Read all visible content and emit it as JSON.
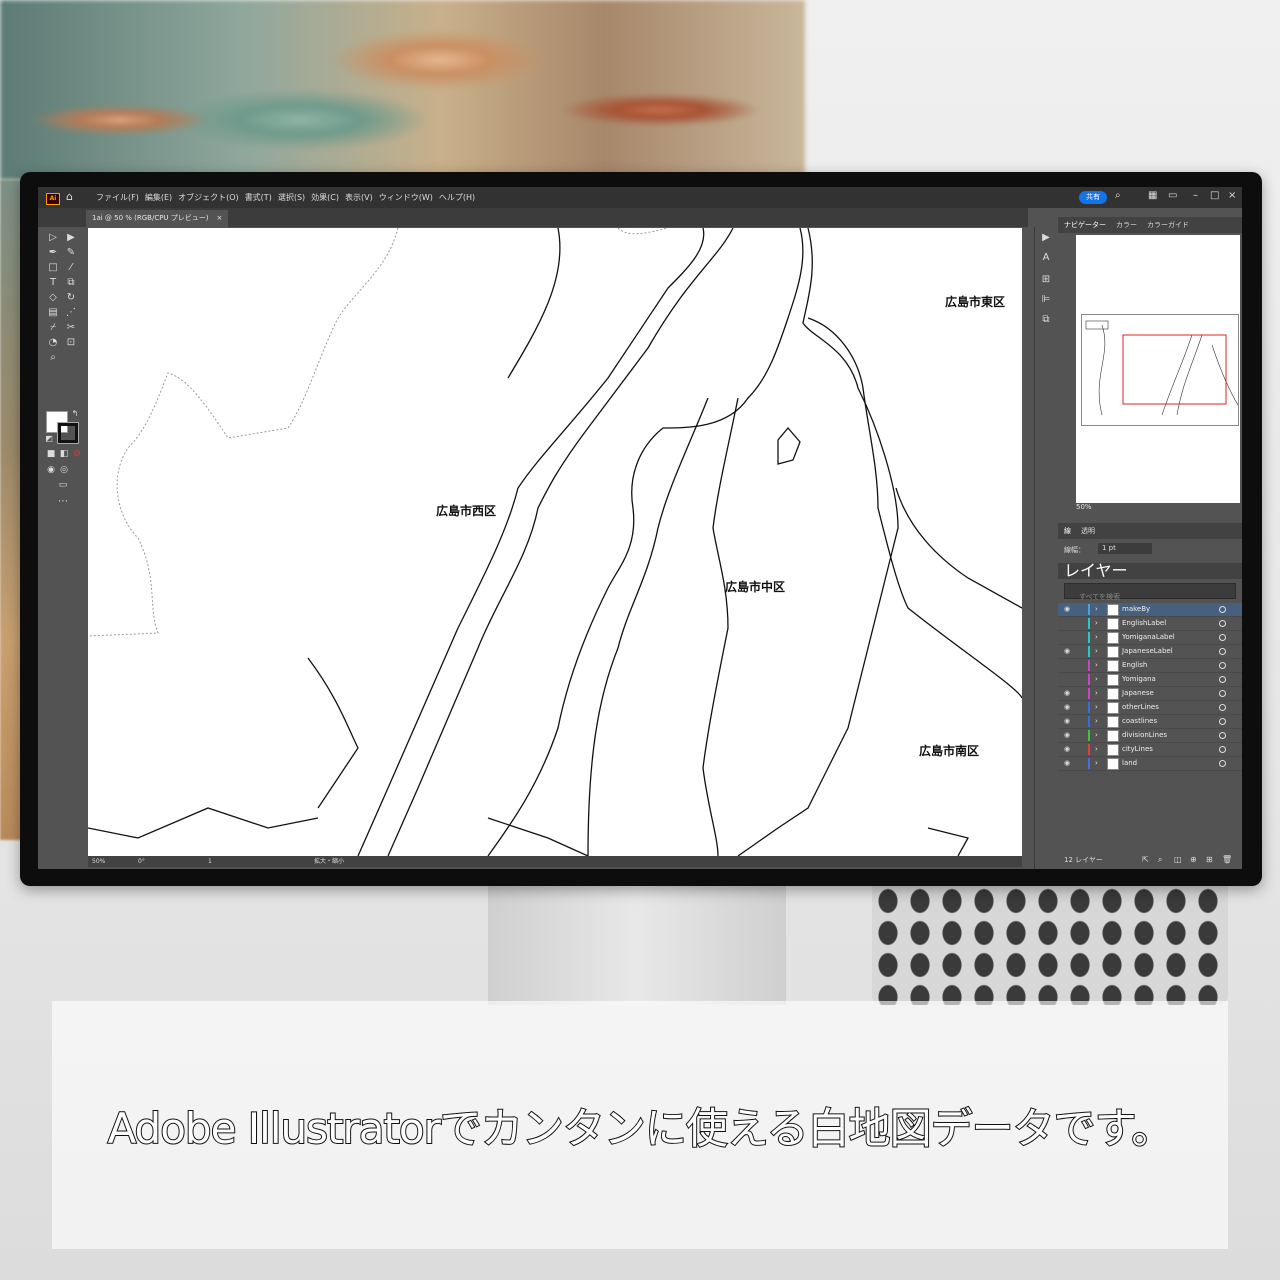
{
  "app": {
    "logo_text": "Ai",
    "menu": [
      "ファイル(F)",
      "編集(E)",
      "オブジェクト(O)",
      "書式(T)",
      "選択(S)",
      "効果(C)",
      "表示(V)",
      "ウィンドウ(W)",
      "ヘルプ(H)"
    ],
    "share_label": "共有",
    "document_tab": "1ai @ 50 % (RGB/CPU プレビュー)",
    "document_tab_close": "×"
  },
  "map": {
    "labels": {
      "higashi": "広島市東区",
      "nishi": "広島市西区",
      "naka": "広島市中区",
      "minami": "広島市南区"
    }
  },
  "navigator": {
    "tabs": [
      "ナビゲーター",
      "カラー",
      "カラーガイド"
    ],
    "zoom": "50%"
  },
  "stroke_panel": {
    "tabs": [
      "線",
      "透明"
    ],
    "weight_label": "線幅：",
    "weight_value": "1 pt"
  },
  "layers_panel": {
    "tab": "レイヤー",
    "search_placeholder": "すべてを検索",
    "layers": [
      {
        "name": "makeBy",
        "color": "#4aa3df",
        "visible": true,
        "selected": true
      },
      {
        "name": "EnglishLabel",
        "color": "#2bc6c6",
        "visible": false,
        "selected": false
      },
      {
        "name": "YomiganaLabel",
        "color": "#2bc6c6",
        "visible": false,
        "selected": false
      },
      {
        "name": "JapaneseLabel",
        "color": "#2bc6c6",
        "visible": true,
        "selected": false
      },
      {
        "name": "English",
        "color": "#c447c4",
        "visible": false,
        "selected": false
      },
      {
        "name": "Yomigana",
        "color": "#c447c4",
        "visible": false,
        "selected": false
      },
      {
        "name": "Japanese",
        "color": "#c447c4",
        "visible": true,
        "selected": false
      },
      {
        "name": "otherLines",
        "color": "#3a6ed8",
        "visible": true,
        "selected": false
      },
      {
        "name": "coastlines",
        "color": "#3a6ed8",
        "visible": true,
        "selected": false
      },
      {
        "name": "divisionLines",
        "color": "#3fc43f",
        "visible": true,
        "selected": false
      },
      {
        "name": "cityLines",
        "color": "#e04040",
        "visible": true,
        "selected": false
      },
      {
        "name": "land",
        "color": "#4a6ee0",
        "visible": true,
        "selected": false
      }
    ],
    "footer_count": "12 レイヤー"
  },
  "status_bar": {
    "zoom": "50%",
    "rotation": "0°",
    "artboard": "1",
    "tool_name": "拡大・縮小"
  },
  "caption": "Adobe Illustratorでカンタンに使える白地図データです。"
}
